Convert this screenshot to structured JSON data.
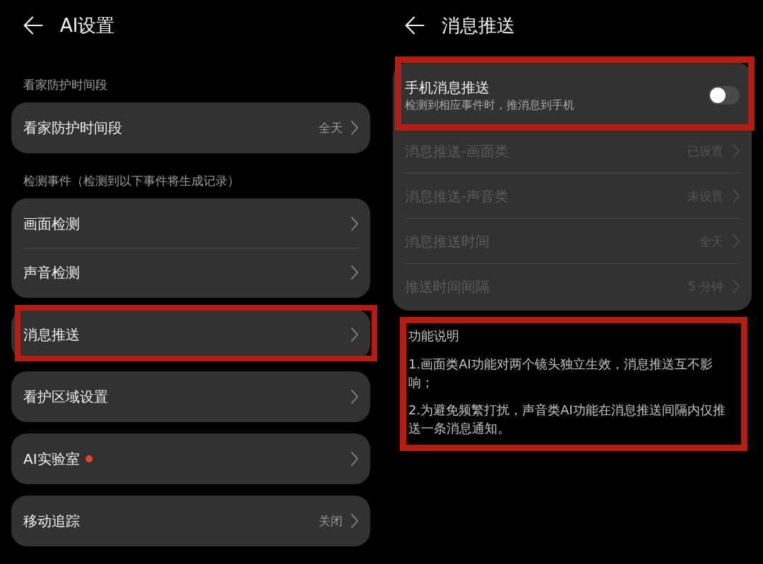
{
  "left_screen": {
    "title": "AI设置",
    "groups": [
      {
        "header": "看家防护时间段",
        "highlighted": false,
        "items": [
          {
            "label": "看家防护时间段",
            "value": "全天",
            "dot": false
          }
        ]
      },
      {
        "header": "检测事件（检测到以下事件将生成记录）",
        "highlighted": false,
        "items": [
          {
            "label": "画面检测",
            "dot": false
          },
          {
            "label": "声音检测",
            "dot": false
          }
        ]
      },
      {
        "highlighted": true,
        "items": [
          {
            "label": "消息推送",
            "dot": false
          }
        ]
      },
      {
        "highlighted": false,
        "items": [
          {
            "label": "看护区域设置",
            "dot": false
          }
        ]
      },
      {
        "highlighted": false,
        "items": [
          {
            "label": "AI实验室",
            "dot": true
          }
        ]
      },
      {
        "highlighted": false,
        "items": [
          {
            "label": "移动追踪",
            "value": "关闭",
            "dot": false
          }
        ]
      }
    ]
  },
  "right_screen": {
    "title": "消息推送",
    "toggle_row": {
      "title": "手机消息推送",
      "subtitle": "检测到相应事件时，推消息到手机",
      "on": false,
      "highlighted": true
    },
    "rows": [
      {
        "label": "消息推送-画面类",
        "value": "已设置",
        "disabled": true
      },
      {
        "label": "消息推送-声音类",
        "value": "未设置",
        "disabled": true
      },
      {
        "label": "消息推送时间",
        "value": "全天",
        "disabled": true
      },
      {
        "label": "推送时间间隔",
        "value": "5 分钟",
        "disabled": true
      }
    ],
    "description": {
      "heading": "功能说明",
      "paragraphs": [
        "1.画面类AI功能对两个镜头独立生效，消息推送互不影响；",
        "2.为避免频繁打扰，声音类AI功能在消息推送间隔内仅推送一条消息通知。"
      ],
      "highlighted": true
    }
  }
}
